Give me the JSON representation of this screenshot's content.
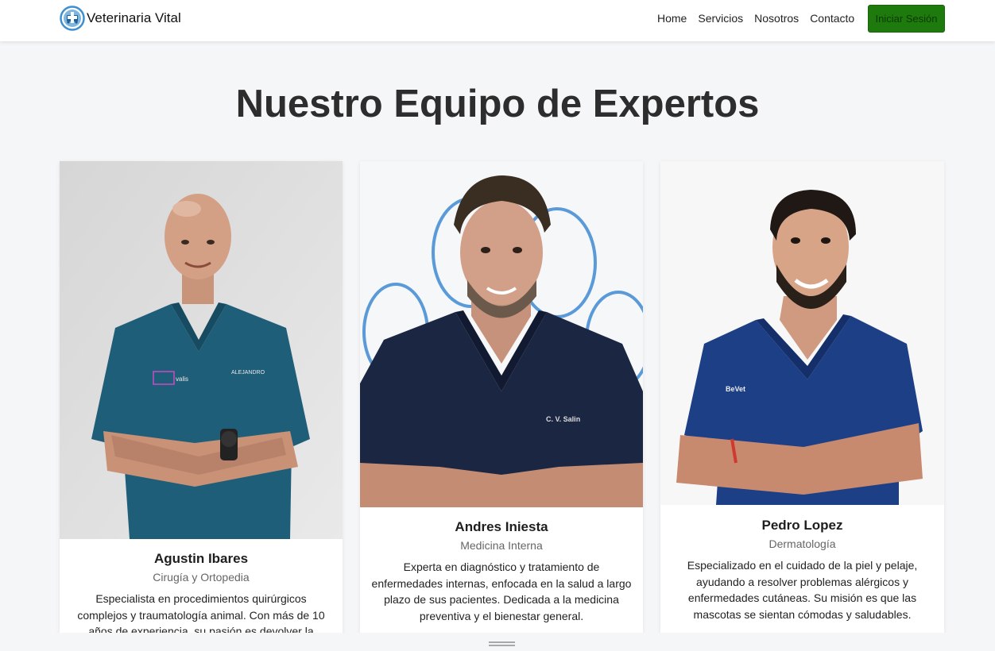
{
  "brand": {
    "name": "Veterinaria Vital",
    "accent": "#3d8fd0"
  },
  "nav": {
    "links": [
      "Home",
      "Servicios",
      "Nosotros",
      "Contacto"
    ],
    "login_label": "Iniciar Sesión",
    "login_color": "#1e7a0c"
  },
  "section": {
    "title": "Nuestro Equipo de Expertos"
  },
  "team": [
    {
      "name": "Agustin Ibares",
      "role": "Cirugía y Ortopedia",
      "description": "Especialista en procedimientos quirúrgicos complejos y traumatología animal. Con más de 10 años de experiencia, su pasión es devolver la movilidad a las",
      "scrub_logo_left": "valis",
      "scrub_logo_right": "ALEJANDRO"
    },
    {
      "name": "Andres Iniesta",
      "role": "Medicina Interna",
      "description": "Experta en diagnóstico y tratamiento de enfermedades internas, enfocada en la salud a largo plazo de sus pacientes. Dedicada a la medicina preventiva y el bienestar general.",
      "scrub_logo_right": "C. V. Salin"
    },
    {
      "name": "Pedro Lopez",
      "role": "Dermatología",
      "description": "Especializado en el cuidado de la piel y pelaje, ayudando a resolver problemas alérgicos y enfermedades cutáneas. Su misión es que las mascotas se sientan cómodas y saludables.",
      "scrub_logo_left": "BeVet"
    }
  ]
}
